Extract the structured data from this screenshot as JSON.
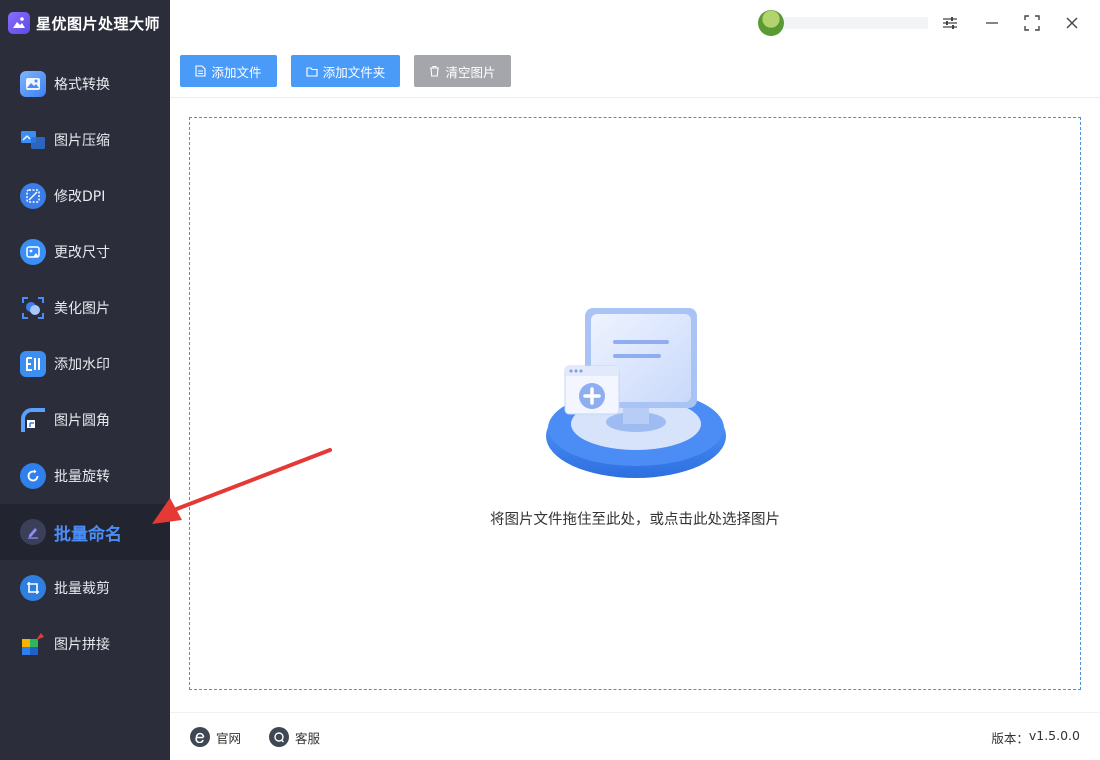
{
  "app": {
    "title": "星优图片处理大师",
    "brand_color": "#6a57ef"
  },
  "sidebar": {
    "active_index": 8,
    "items": [
      {
        "label": "格式转换",
        "icon": "image-convert-icon"
      },
      {
        "label": "图片压缩",
        "icon": "image-compress-icon"
      },
      {
        "label": "修改DPI",
        "icon": "dpi-icon"
      },
      {
        "label": "更改尺寸",
        "icon": "resize-icon"
      },
      {
        "label": "美化图片",
        "icon": "beautify-icon"
      },
      {
        "label": "添加水印",
        "icon": "watermark-icon"
      },
      {
        "label": "图片圆角",
        "icon": "rounded-corner-icon"
      },
      {
        "label": "批量旋转",
        "icon": "rotate-icon"
      },
      {
        "label": "批量命名",
        "icon": "rename-icon"
      },
      {
        "label": "批量裁剪",
        "icon": "crop-icon"
      },
      {
        "label": "图片拼接",
        "icon": "puzzle-icon"
      }
    ]
  },
  "topbar": {
    "icons": [
      "avatar",
      "settings-sliders-icon",
      "minimize-icon",
      "maximize-icon",
      "close-icon"
    ]
  },
  "toolbar": {
    "add_file": "添加文件",
    "add_folder": "添加文件夹",
    "clear_images": "清空图片"
  },
  "dropzone": {
    "hint": "将图片文件拖住至此处，或点击此处选择图片"
  },
  "footer": {
    "website": "官网",
    "support": "客服",
    "version_label": "版本：",
    "version": "v1.5.0.0"
  },
  "colors": {
    "sidebar_bg": "#2b2e3a",
    "accent": "#4a9bf7",
    "active_text": "#4b8df8",
    "clear_button": "#a4a6ab",
    "annotation_arrow": "#e53935"
  }
}
